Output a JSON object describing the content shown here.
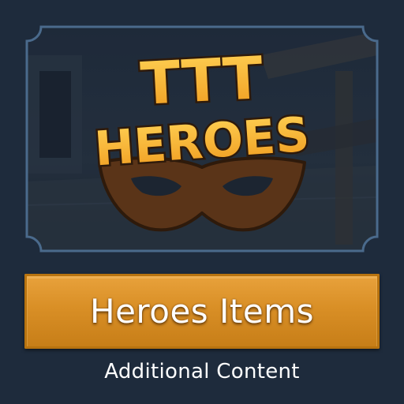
{
  "logo": {
    "line1": "TTT",
    "line2": "HEROES"
  },
  "banner": {
    "title": "Heroes Items"
  },
  "subtitle": "Additional Content",
  "colors": {
    "background": "#1e2b3c",
    "frame_border": "#4a6a8c",
    "banner_gold": "#d98f26",
    "logo_yellow": "#f6b22a",
    "mask_brown": "#5a3418"
  },
  "icons": [
    "mask-icon"
  ]
}
